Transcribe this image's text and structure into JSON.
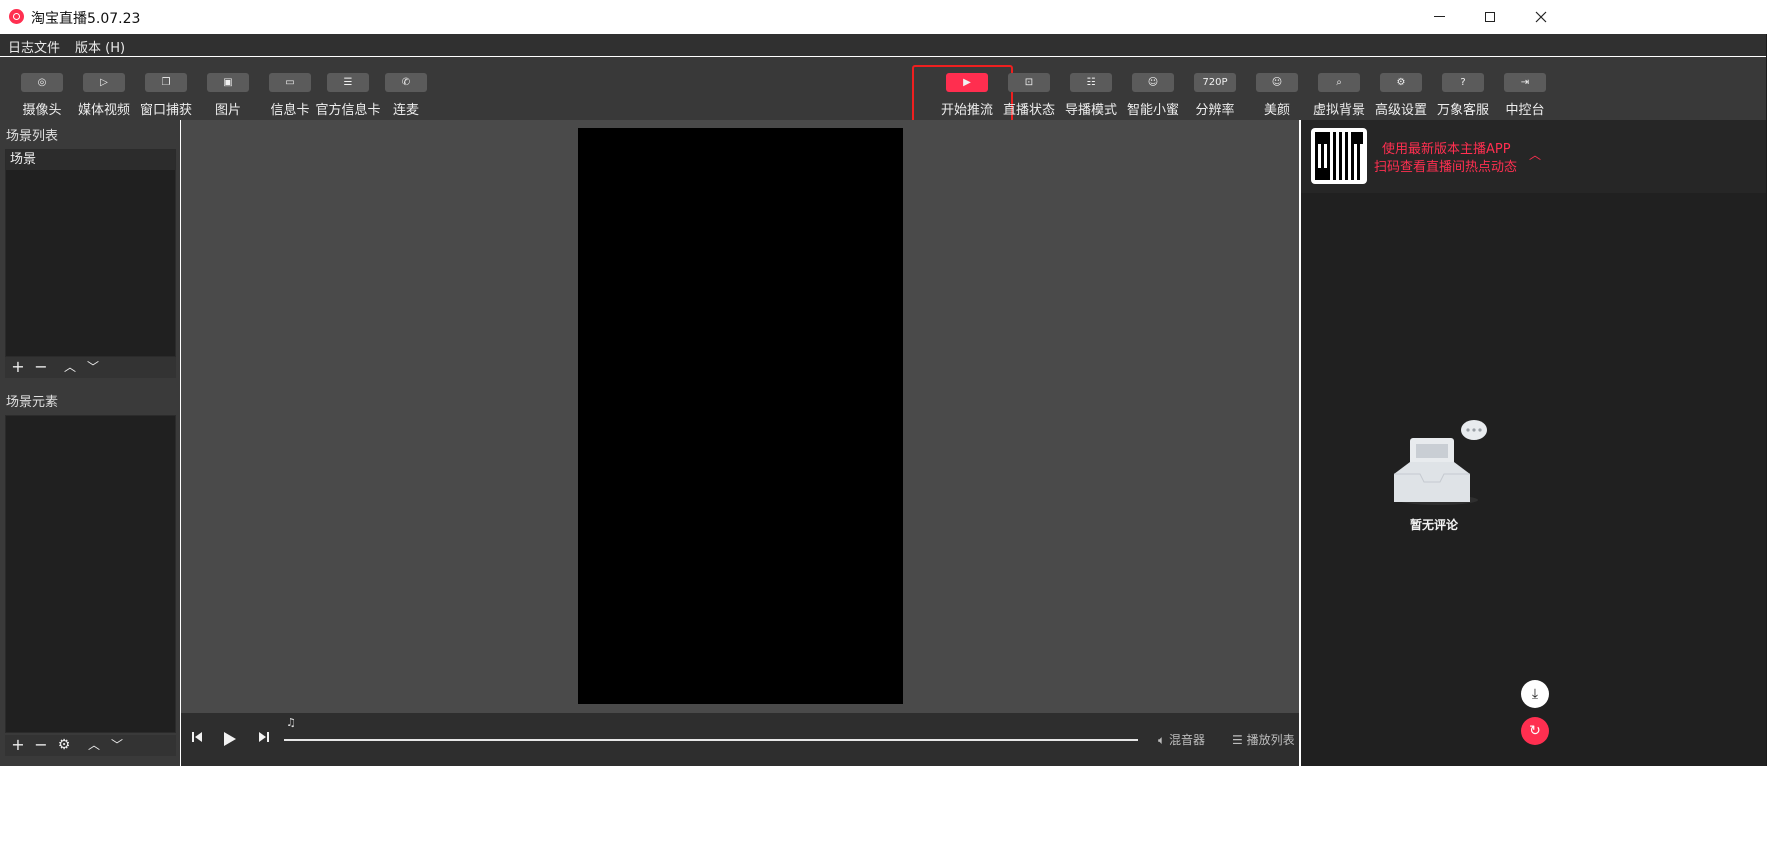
{
  "window": {
    "title": "淘宝直播5.07.23"
  },
  "menu": {
    "items": [
      "日志文件",
      "版本 (H)"
    ]
  },
  "toolbar": {
    "left_tools": [
      "摄像头",
      "媒体视频",
      "窗口捕获",
      "图片",
      "信息卡",
      "官方信息卡",
      "连麦"
    ],
    "right_tools": [
      "开始推流",
      "直播状态",
      "导播模式",
      "智能小蜜",
      "分辨率",
      "美颜",
      "虚拟背景",
      "高级设置",
      "万象客服",
      "中控台"
    ],
    "resolution_badge": "720P"
  },
  "scenes": {
    "title": "场景列表",
    "items": [
      "场景"
    ]
  },
  "elements": {
    "title": "场景元素"
  },
  "player": {
    "mixer_label": "混音器",
    "playlist_label": "播放列表"
  },
  "promo": {
    "line1": "使用最新版本主播APP",
    "line2": "扫码查看直播间热点动态"
  },
  "comments": {
    "empty_text": "暂无评论"
  },
  "colors": {
    "accent": "#ff2f50",
    "highlight_box": "#ef1f1f"
  }
}
